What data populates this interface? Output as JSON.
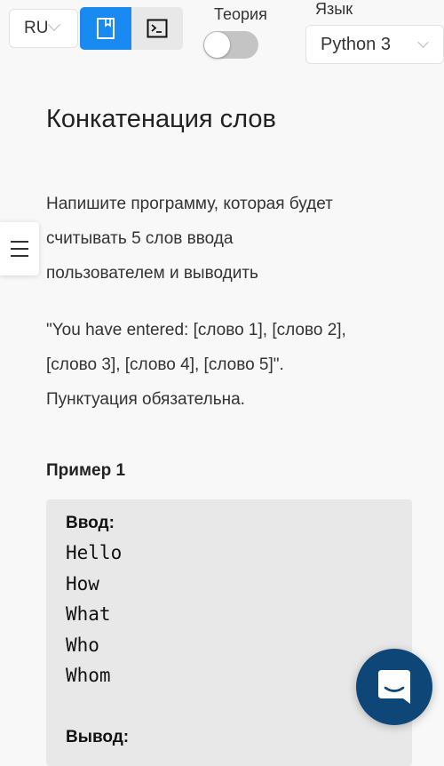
{
  "toolbar": {
    "locale": "RU",
    "theory_label": "Теория",
    "theory_enabled": false,
    "language_label": "Язык",
    "language_value": "Python 3",
    "modes": [
      {
        "name": "book-icon",
        "active": true
      },
      {
        "name": "terminal-icon",
        "active": false
      }
    ]
  },
  "task": {
    "title": "Конкатенация слов",
    "description_lines": [
      "Напишите программу, которая будет",
      "считывать 5 слов ввода",
      "пользователем и выводить"
    ],
    "output_format_lines": [
      "\"You have entered: [слово 1], [слово 2],",
      "[слово 3], [слово 4], [слово 5]\".",
      "Пунктуация обязательна."
    ]
  },
  "example": {
    "title": "Пример 1",
    "input_label": "Ввод:",
    "input_lines": [
      "Hello",
      "How",
      "What",
      "Who",
      "Whom"
    ],
    "output_label": "Вывод:"
  },
  "colors": {
    "accent": "#1a8af3",
    "chat_button": "#0d4677"
  }
}
